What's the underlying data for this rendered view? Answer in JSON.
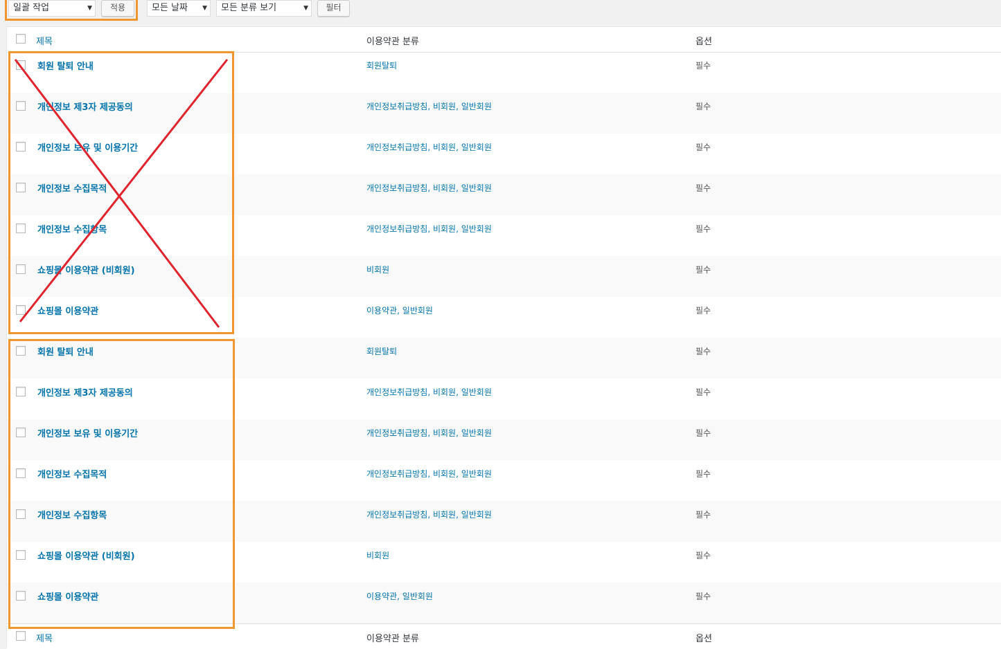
{
  "toolbar": {
    "bulk_action": "일괄 작업",
    "apply": "적용",
    "date_filter": "모든 날짜",
    "category_filter": "모든 분류 보기",
    "filter": "필터"
  },
  "table": {
    "headers": {
      "title": "제목",
      "category": "이용약관 분류",
      "option": "옵션"
    },
    "rows": [
      {
        "title": "회원 탈퇴 안내",
        "category": "회원탈퇴",
        "option": "필수"
      },
      {
        "title": "개인정보 제3자 제공동의",
        "category": "개인정보취급방침, 비회원, 일반회원",
        "option": "필수"
      },
      {
        "title": "개인정보 보유 및 이용기간",
        "category": "개인정보취급방침, 비회원, 일반회원",
        "option": "필수"
      },
      {
        "title": "개인정보 수집목적",
        "category": "개인정보취급방침, 비회원, 일반회원",
        "option": "필수"
      },
      {
        "title": "개인정보 수집항목",
        "category": "개인정보취급방침, 비회원, 일반회원",
        "option": "필수"
      },
      {
        "title": "쇼핑몰 이용약관 (비회원)",
        "category": "비회원",
        "option": "필수"
      },
      {
        "title": "쇼핑몰 이용약관",
        "category": "이용약관, 일반회원",
        "option": "필수"
      },
      {
        "title": "회원 탈퇴 안내",
        "category": "회원탈퇴",
        "option": "필수"
      },
      {
        "title": "개인정보 제3자 제공동의",
        "category": "개인정보취급방침, 비회원, 일반회원",
        "option": "필수"
      },
      {
        "title": "개인정보 보유 및 이용기간",
        "category": "개인정보취급방침, 비회원, 일반회원",
        "option": "필수"
      },
      {
        "title": "개인정보 수집목적",
        "category": "개인정보취급방침, 비회원, 일반회원",
        "option": "필수"
      },
      {
        "title": "개인정보 수집항목",
        "category": "개인정보취급방침, 비회원, 일반회원",
        "option": "필수"
      },
      {
        "title": "쇼핑몰 이용약관 (비회원)",
        "category": "비회원",
        "option": "필수"
      },
      {
        "title": "쇼핑몰 이용약관",
        "category": "이용약관, 일반회원",
        "option": "필수"
      }
    ]
  },
  "colors": {
    "link": "#0073aa",
    "highlight": "#f0962e",
    "cross": "#e0242d"
  }
}
